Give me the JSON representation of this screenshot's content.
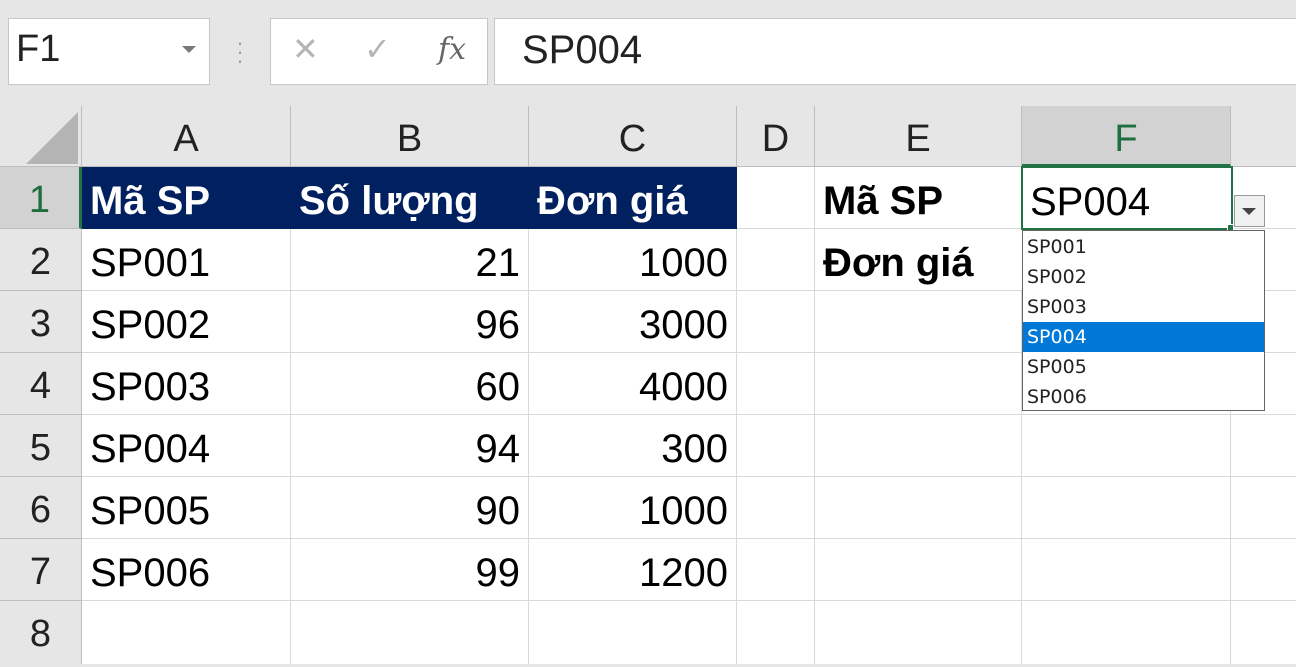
{
  "formula_bar": {
    "name_box": "F1",
    "cancel_icon": "close-icon",
    "enter_icon": "check-icon",
    "fx_label": "fx",
    "formula": "SP004"
  },
  "columns": [
    "A",
    "B",
    "C",
    "D",
    "E",
    "F"
  ],
  "selected_column": "F",
  "rows": [
    "1",
    "2",
    "3",
    "4",
    "5",
    "6",
    "7",
    "8"
  ],
  "selected_row": "1",
  "table": {
    "headers": [
      "Mã SP",
      "Số lượng",
      "Đơn giá"
    ],
    "data": [
      [
        "SP001",
        "21",
        "1000"
      ],
      [
        "SP002",
        "96",
        "3000"
      ],
      [
        "SP003",
        "60",
        "4000"
      ],
      [
        "SP004",
        "94",
        "300"
      ],
      [
        "SP005",
        "90",
        "1000"
      ],
      [
        "SP006",
        "99",
        "1200"
      ]
    ]
  },
  "lookup": {
    "code_label": "Mã SP",
    "price_label": "Đơn giá",
    "selected_code": "SP004"
  },
  "dropdown": {
    "options": [
      "SP001",
      "SP002",
      "SP003",
      "SP004",
      "SP005",
      "SP006"
    ],
    "selected_index": 3
  },
  "colors": {
    "header_fill": "#002060",
    "accent": "#217346",
    "list_highlight": "#0078d7"
  }
}
